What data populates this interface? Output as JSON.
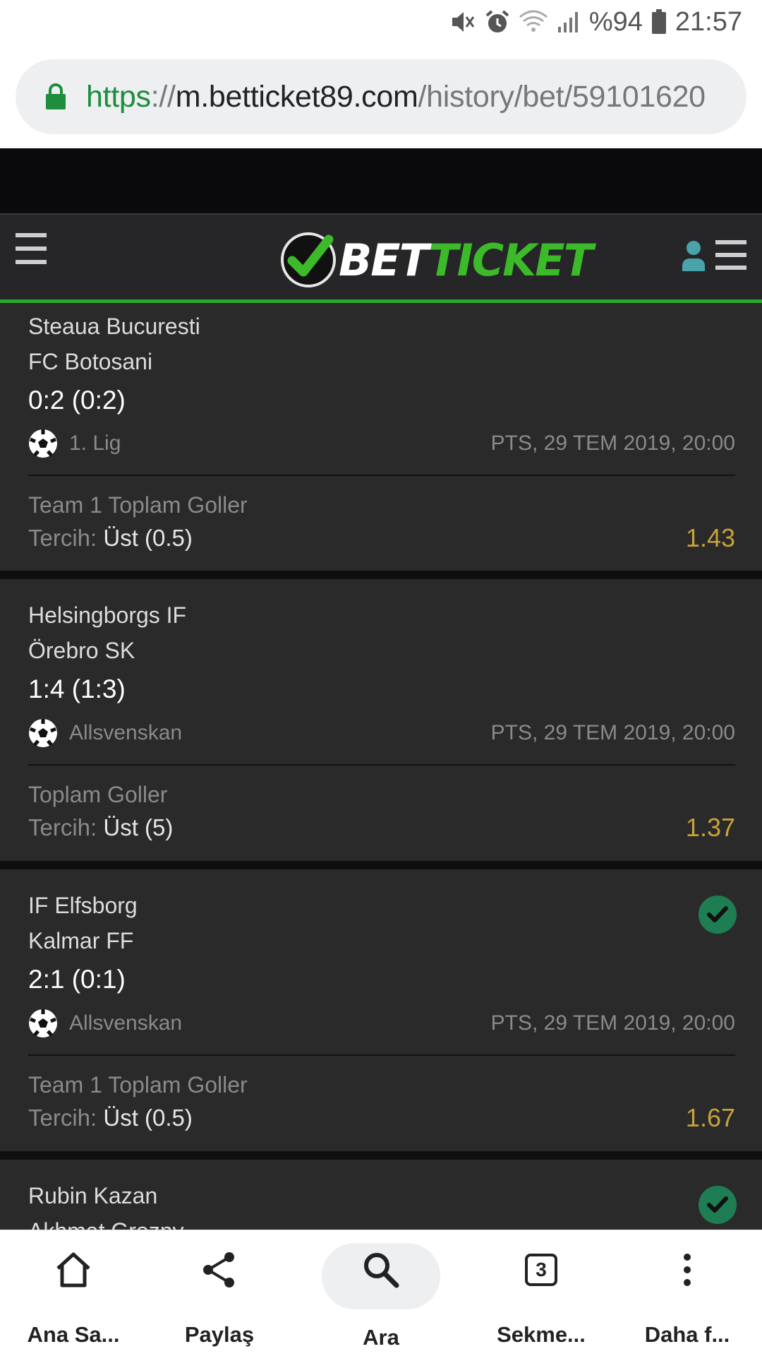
{
  "status_bar": {
    "battery": "%94",
    "time": "21:57"
  },
  "url_bar": {
    "scheme": "https",
    "separator": "://",
    "host": "m.betticket89.com",
    "path": "/history/bet/59101620"
  },
  "header": {
    "logo_white": "BET",
    "logo_green": "TICKET"
  },
  "bets": [
    {
      "team1": "Steaua Bucuresti",
      "team2": "FC Botosani",
      "score": "0:2 (0:2)",
      "league": "1. Lig",
      "date": "PTS, 29 TEM 2019, 20:00",
      "market": "Team 1 Toplam Goller",
      "choice_label": "Tercih:",
      "choice_value": "Üst (0.5)",
      "odds": "1.43",
      "won": false
    },
    {
      "team1": "Helsingborgs IF",
      "team2": "Örebro SK",
      "score": "1:4 (1:3)",
      "league": "Allsvenskan",
      "date": "PTS, 29 TEM 2019, 20:00",
      "market": "Toplam Goller",
      "choice_label": "Tercih:",
      "choice_value": "Üst (5)",
      "odds": "1.37",
      "won": false
    },
    {
      "team1": "IF Elfsborg",
      "team2": "Kalmar FF",
      "score": "2:1 (0:1)",
      "league": "Allsvenskan",
      "date": "PTS, 29 TEM 2019, 20:00",
      "market": "Team 1 Toplam Goller",
      "choice_label": "Tercih:",
      "choice_value": "Üst (0.5)",
      "odds": "1.67",
      "won": true
    },
    {
      "team1": "Rubin Kazan",
      "team2": "Akhmat Grozny",
      "won": true
    }
  ],
  "bottom_nav": {
    "home": "Ana Sa...",
    "share": "Paylaş",
    "search": "Ara",
    "tabs": "Sekme...",
    "tabs_count": "3",
    "more": "Daha f..."
  },
  "colors": {
    "brand_green": "#3cba2a",
    "odds": "#c8a23a",
    "won_check": "#1e7d52",
    "card_bg": "#2a2a2b"
  }
}
